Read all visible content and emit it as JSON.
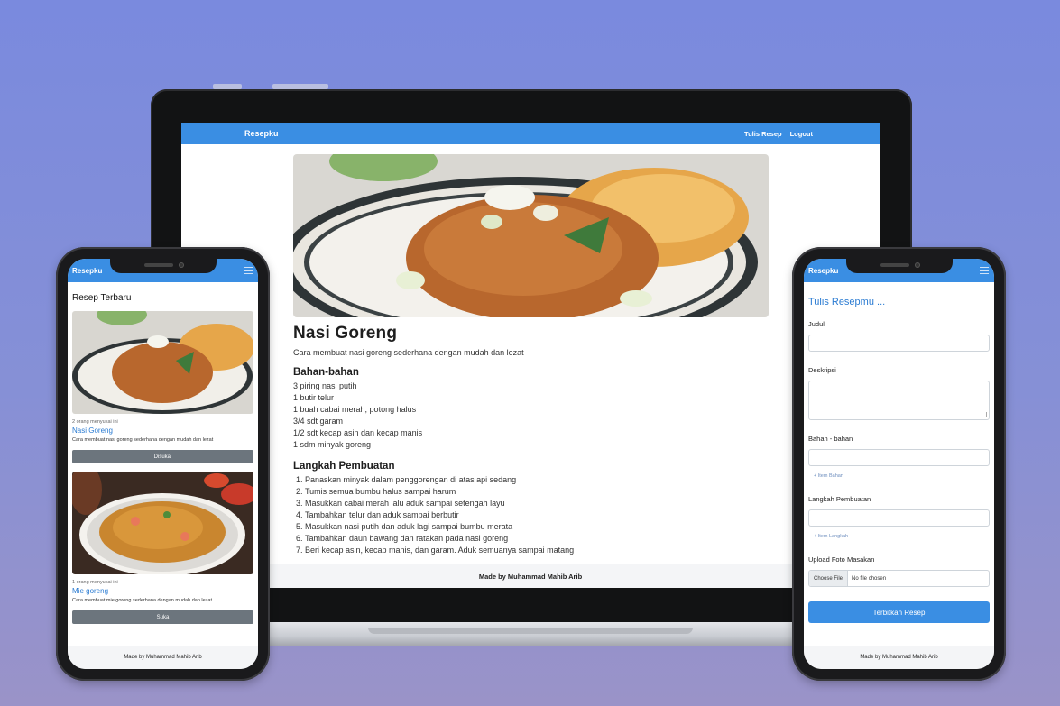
{
  "laptop": {
    "brand": "Resepku",
    "nav_links": [
      "Tulis Resep",
      "Logout"
    ],
    "recipe": {
      "title": "Nasi Goreng",
      "description": "Cara membuat nasi goreng sederhana dengan mudah dan lezat",
      "ingredients_heading": "Bahan-bahan",
      "ingredients": [
        "3 piring nasi putih",
        "1 butir telur",
        "1 buah cabai merah, potong halus",
        "3/4 sdt garam",
        "1/2 sdt kecap asin dan kecap manis",
        "1 sdm minyak goreng"
      ],
      "steps_heading": "Langkah Pembuatan",
      "steps": [
        "Panaskan minyak dalam penggorengan di atas api sedang",
        "Tumis semua bumbu halus sampai harum",
        "Masukkan cabai merah lalu aduk sampai setengah layu",
        "Tambahkan telur dan aduk sampai berbutir",
        "Masukkan nasi putih dan aduk lagi sampai bumbu merata",
        "Tambahkan daun bawang dan ratakan pada nasi goreng",
        "Beri kecap asin, kecap manis, dan garam. Aduk semuanya sampai matang"
      ]
    },
    "footer": "Made by Muhammad Mahib Arib"
  },
  "left_phone": {
    "brand": "Resepku",
    "heading": "Resep Terbaru",
    "cards": [
      {
        "likes": "2 orang menyukai ini",
        "title": "Nasi Goreng",
        "description": "Cara membuat nasi goreng sederhana dengan mudah dan lezat",
        "button": "Disukai"
      },
      {
        "likes": "1 orang menyukai ini",
        "title": "Mie goreng",
        "description": "Cara membuat mie goreng sederhana dengan mudah dan lezat",
        "button": "Suka"
      }
    ],
    "footer": "Made by Muhammad Mahib Arib"
  },
  "right_phone": {
    "brand": "Resepku",
    "heading": "Tulis Resepmu ...",
    "labels": {
      "title": "Judul",
      "description": "Deskripsi",
      "ingredients": "Bahan - bahan",
      "steps": "Langkah Pembuatan",
      "photo": "Upload Foto Masakan"
    },
    "add_ingredient": "+ Item Bahan",
    "add_step": "+ Item Langkah",
    "file_button": "Choose File",
    "file_status": "No file chosen",
    "submit": "Terbitkan Resep",
    "footer": "Made by Muhammad Mahib Arib"
  },
  "colors": {
    "background": "#7a8ade",
    "navbar": "#3a8ee3",
    "link": "#2a7bd2",
    "secondary_button": "#6c757d"
  }
}
